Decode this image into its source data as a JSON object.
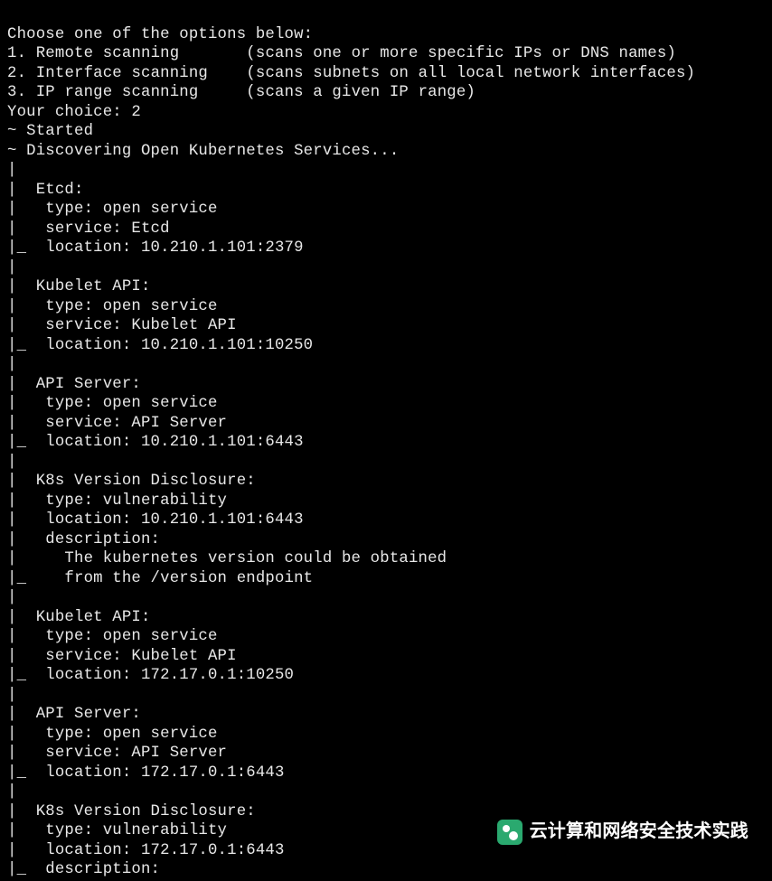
{
  "prompt": {
    "header": "Choose one of the options below:",
    "options": [
      {
        "num": "1.",
        "name": "Remote scanning",
        "desc": "(scans one or more specific IPs or DNS names)"
      },
      {
        "num": "2.",
        "name": "Interface scanning",
        "desc": "(scans subnets on all local network interfaces)"
      },
      {
        "num": "3.",
        "name": "IP range scanning",
        "desc": "(scans a given IP range)"
      }
    ],
    "choice_label": "Your choice: ",
    "choice_value": "2"
  },
  "status": {
    "started": "~ Started",
    "discovering": "~ Discovering Open Kubernetes Services..."
  },
  "findings": [
    {
      "title": "Etcd:",
      "lines": [
        "type: open service",
        "service: Etcd",
        "location: 10.210.1.101:2379"
      ]
    },
    {
      "title": "Kubelet API:",
      "lines": [
        "type: open service",
        "service: Kubelet API",
        "location: 10.210.1.101:10250"
      ]
    },
    {
      "title": "API Server:",
      "lines": [
        "type: open service",
        "service: API Server",
        "location: 10.210.1.101:6443"
      ]
    },
    {
      "title": "K8s Version Disclosure:",
      "lines": [
        "type: vulnerability",
        "location: 10.210.1.101:6443",
        "description:",
        "  The kubernetes version could be obtained",
        "  from the /version endpoint"
      ]
    },
    {
      "title": "Kubelet API:",
      "lines": [
        "type: open service",
        "service: Kubelet API",
        "location: 172.17.0.1:10250"
      ]
    },
    {
      "title": "API Server:",
      "lines": [
        "type: open service",
        "service: API Server",
        "location: 172.17.0.1:6443"
      ]
    },
    {
      "title": "K8s Version Disclosure:",
      "lines": [
        "type: vulnerability",
        "location: 172.17.0.1:6443",
        "description:"
      ],
      "no_trailing_connector": true
    }
  ],
  "watermark": "云计算和网络安全技术实践"
}
